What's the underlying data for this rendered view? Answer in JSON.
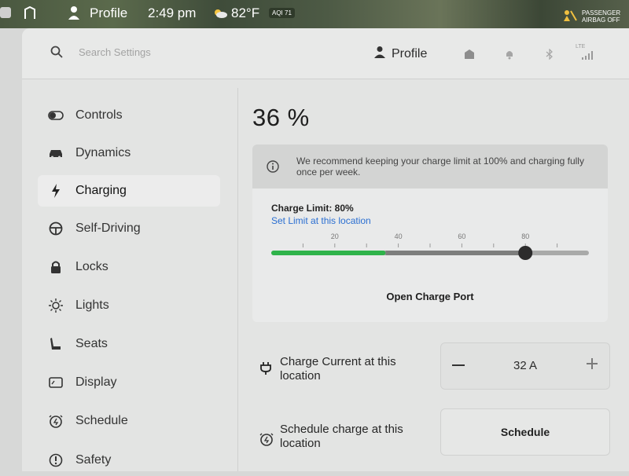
{
  "status_bar": {
    "profile_label": "Profile",
    "time": "2:49 pm",
    "temperature": "82°F",
    "aqi": "AQI 71",
    "airbag_line1": "PASSENGER",
    "airbag_line2": "AIRBAG OFF"
  },
  "header": {
    "search_placeholder": "Search Settings",
    "profile_label": "Profile",
    "lte": "LTE"
  },
  "sidebar": {
    "items": [
      {
        "label": "Controls",
        "icon": "toggle-icon"
      },
      {
        "label": "Dynamics",
        "icon": "car-icon"
      },
      {
        "label": "Charging",
        "icon": "lightning-icon",
        "active": true
      },
      {
        "label": "Self-Driving",
        "icon": "steering-wheel-icon"
      },
      {
        "label": "Locks",
        "icon": "lock-icon"
      },
      {
        "label": "Lights",
        "icon": "sun-icon"
      },
      {
        "label": "Seats",
        "icon": "seat-icon"
      },
      {
        "label": "Display",
        "icon": "display-icon"
      },
      {
        "label": "Schedule",
        "icon": "clock-icon"
      },
      {
        "label": "Safety",
        "icon": "alert-icon"
      }
    ]
  },
  "charging": {
    "battery_percent": "36 %",
    "info_text": "We recommend keeping your charge limit at 100% and charging fully once per week.",
    "limit_label": "Charge Limit: 80%",
    "limit_link": "Set Limit at this location",
    "slider_ticks": [
      "20",
      "40",
      "60",
      "80"
    ],
    "current_level_pct": 36,
    "limit_pct": 80,
    "open_port_label": "Open Charge Port",
    "current_row_label": "Charge Current at this location",
    "current_value": "32 A",
    "schedule_row_label": "Schedule charge at this location",
    "schedule_button": "Schedule"
  },
  "colors": {
    "accent_green": "#2fb34a",
    "link_blue": "#2b6fd1",
    "background": "#e3e4e3"
  }
}
